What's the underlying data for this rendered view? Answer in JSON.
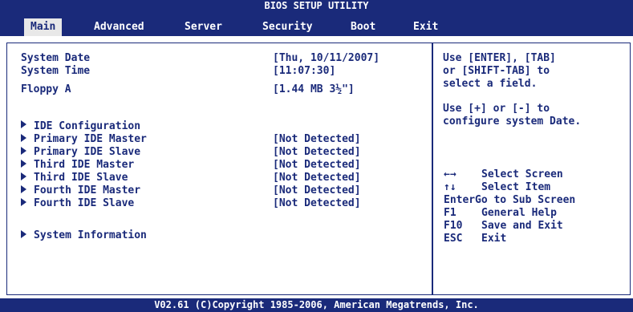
{
  "title": "BIOS SETUP UTILITY",
  "tabs": [
    {
      "label": "Main"
    },
    {
      "label": "Advanced"
    },
    {
      "label": "Server"
    },
    {
      "label": "Security"
    },
    {
      "label": "Boot"
    },
    {
      "label": "Exit"
    }
  ],
  "active_tab": "Main",
  "settings": {
    "system_date": {
      "label": "System Date",
      "value": "[Thu, 10/11/2007]"
    },
    "system_time": {
      "label": "System Time",
      "value": "[11:07:30]"
    },
    "floppy_a": {
      "label": "Floppy A",
      "value": "[1.44 MB 3½\"]"
    }
  },
  "submenus": [
    {
      "label": "IDE Configuration",
      "value": ""
    },
    {
      "label": "Primary IDE Master",
      "value": "[Not Detected]"
    },
    {
      "label": "Primary IDE Slave",
      "value": "[Not Detected]"
    },
    {
      "label": "Third IDE Master",
      "value": "[Not Detected]"
    },
    {
      "label": "Third IDE Slave",
      "value": "[Not Detected]"
    },
    {
      "label": "Fourth IDE Master",
      "value": "[Not Detected]"
    },
    {
      "label": "Fourth IDE Slave",
      "value": "[Not Detected]"
    },
    {
      "label": "System Information",
      "value": ""
    }
  ],
  "help": {
    "lines": [
      "Use [ENTER], [TAB]",
      "or [SHIFT-TAB] to",
      "select a field.",
      "",
      "Use [+] or [-] to",
      "configure system Date."
    ]
  },
  "keys": [
    {
      "key": "←→",
      "action": "Select Screen"
    },
    {
      "key": "↑↓",
      "action": "Select Item"
    },
    {
      "key": "Enter",
      "action": "Go to Sub Screen"
    },
    {
      "key": "F1",
      "action": "General Help"
    },
    {
      "key": "F10",
      "action": "Save and Exit"
    },
    {
      "key": "ESC",
      "action": "Exit"
    }
  ],
  "footer": "V02.61 (C)Copyright 1985-2006, American Megatrends, Inc.",
  "colors": {
    "primary": "#1a2a7a",
    "background": "#ffffff",
    "active_tab_bg": "#e8e8e8"
  }
}
